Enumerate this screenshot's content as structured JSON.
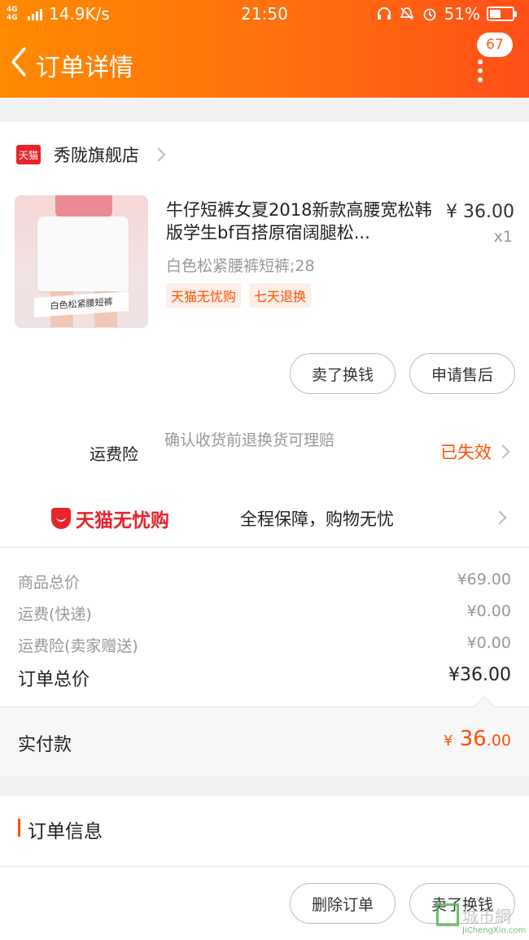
{
  "status_bar": {
    "network": "4G 4G",
    "speed": "14.9K/s",
    "time": "21:50",
    "battery_text": "51%",
    "battery_level": 0.51,
    "icons": [
      "headset-icon",
      "mute-icon",
      "alarm-icon"
    ]
  },
  "nav": {
    "title": "订单详情",
    "badge": "67"
  },
  "store": {
    "logo_text": "天猫",
    "name": "秀陇旗舰店"
  },
  "product": {
    "title": "牛仔短裤女夏2018新款高腰宽松韩版学生bf百搭原宿阔腿松...",
    "price": "¥ 36.00",
    "qty": "x1",
    "sku": "白色松紧腰裤短裤;28",
    "image_caption": "白色松紧腰短裤",
    "tags": [
      "天猫无忧购",
      "七天退换"
    ]
  },
  "item_actions": {
    "sell": "卖了换钱",
    "after_sale": "申请售后"
  },
  "insurance": {
    "label": "运费险",
    "desc": "确认收货前退换货可理赔",
    "status": "已失效"
  },
  "worry_free": {
    "logo_text": "天猫无忧购",
    "slogan": "全程保障，购物无忧"
  },
  "fees": [
    {
      "label": "商品总价",
      "value": "¥69.00"
    },
    {
      "label": "运费(快递)",
      "value": "¥0.00"
    },
    {
      "label": "运费险(卖家赠送)",
      "value": "¥0.00"
    }
  ],
  "order_total": {
    "label": "订单总价",
    "value": "¥36.00"
  },
  "paid": {
    "label": "实付款",
    "currency": "¥",
    "int": "36",
    "dec": ".00"
  },
  "order_info": {
    "title": "订单信息"
  },
  "bottom_actions": {
    "delete": "删除订单",
    "sell": "卖了换钱"
  },
  "watermark": {
    "text": "城市網",
    "sub": "JiChengXin.com"
  },
  "colors": {
    "accent": "#ff5000",
    "tmall_red": "#e8232b"
  }
}
